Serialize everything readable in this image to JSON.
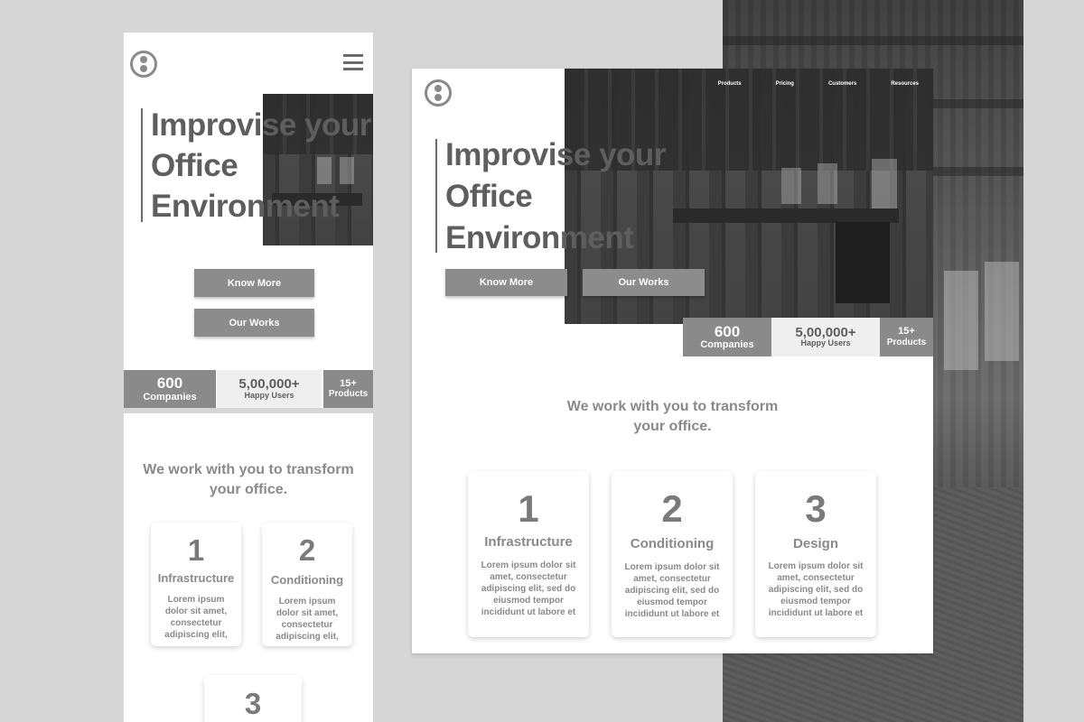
{
  "nav": {
    "items": [
      "Products",
      "Pricing",
      "Customers",
      "Resources"
    ]
  },
  "hero": {
    "line1": "Improvise your",
    "line2": "Office",
    "line3": "Environment"
  },
  "buttons": {
    "know_more": "Know More",
    "our_works": "Our Works"
  },
  "stats": [
    {
      "num": "600",
      "label": "Companies"
    },
    {
      "num": "5,00,000+",
      "label": "Happy Users"
    },
    {
      "num": "15+",
      "label": "Products"
    }
  ],
  "tagline": {
    "line1": "We work with you to transform",
    "line2": "your office."
  },
  "cards": [
    {
      "num": "1",
      "title": "Infrastructure",
      "text_desktop": "Lorem ipsum dolor sit amet, consectetur adipiscing elit, sed do eiusmod tempor incididunt ut labore et",
      "text_mobile": "Lorem ipsum dolor sit amet, consectetur adipiscing elit,"
    },
    {
      "num": "2",
      "title": "Conditioning",
      "text_desktop": "Lorem ipsum dolor sit amet, consectetur adipiscing elit, sed do eiusmod tempor incididunt ut labore et",
      "text_mobile": "Lorem ipsum dolor sit amet, consectetur adipiscing elit,"
    },
    {
      "num": "3",
      "title": "Design",
      "text_desktop": "Lorem ipsum dolor sit amet, consectetur adipiscing elit, sed do eiusmod tempor incididunt ut labore et"
    }
  ],
  "icons": {
    "logo": "logo-icon",
    "menu": "hamburger-menu-icon"
  },
  "colors": {
    "background": "#d6d6d6",
    "accent": "#8c8c8c",
    "text": "#5e5e5e"
  }
}
